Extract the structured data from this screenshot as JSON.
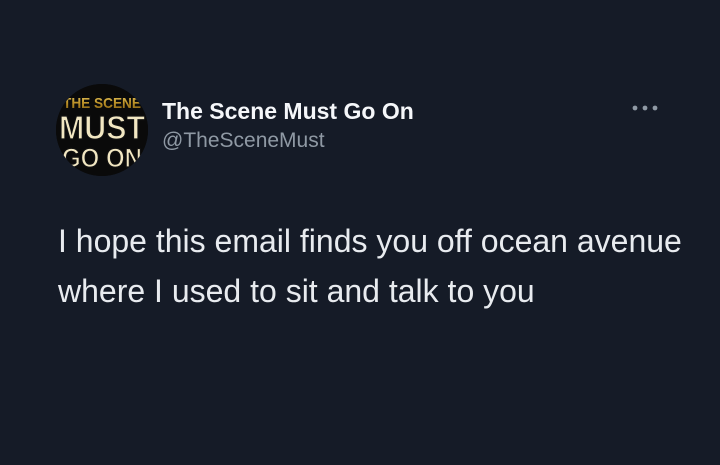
{
  "tweet": {
    "author": {
      "display_name": "The Scene Must Go On",
      "handle": "@TheSceneMust",
      "avatar": {
        "icon": "scene-must-go-on-logo",
        "lines": [
          "THE SCENE",
          "MUST",
          "GO ON"
        ],
        "colors": {
          "background": "#0a0a0a",
          "gold": "#c9a33a",
          "text_fill": "#f2e7c2"
        }
      }
    },
    "more_icon": "ellipsis-icon",
    "text": "I hope this email finds you off ocean avenue where I used to sit and talk to you"
  },
  "theme": {
    "background": "#151b27",
    "name_color": "#f5f7fa",
    "handle_color": "#8f99a4",
    "text_color": "#e8ebef"
  }
}
